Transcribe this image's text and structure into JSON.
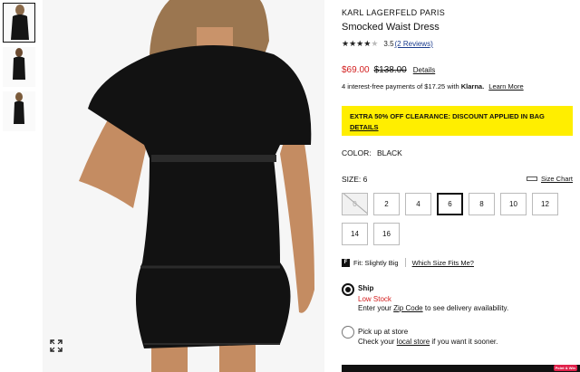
{
  "thumbnails": [
    {
      "name": "thumb-front",
      "active": true
    },
    {
      "name": "thumb-back",
      "active": false
    },
    {
      "name": "thumb-side",
      "active": false
    }
  ],
  "product": {
    "brand": "KARL LAGERFELD PARIS",
    "title": "Smocked Waist Dress",
    "rating_value": 3.5,
    "rating_text": "3.5",
    "reviews_text": "(2 Reviews)",
    "sale_price": "$69.00",
    "original_price": "$138.00",
    "details_label": "Details",
    "klarna_prefix": "4 interest-free payments of $17.25 with",
    "klarna_brand": "Klarna.",
    "klarna_learn_more": "Learn More"
  },
  "promo": {
    "headline": "EXTRA 50% OFF CLEARANCE: DISCOUNT APPLIED IN BAG",
    "link": "DETAILS",
    "background": "#ffee00"
  },
  "color": {
    "label": "COLOR:",
    "value": "BLACK"
  },
  "size": {
    "label": "SIZE:",
    "selected": "6",
    "size_chart_label": "Size Chart",
    "options": [
      {
        "label": "0",
        "state": "unavailable"
      },
      {
        "label": "2",
        "state": "available"
      },
      {
        "label": "4",
        "state": "available"
      },
      {
        "label": "6",
        "state": "selected"
      },
      {
        "label": "8",
        "state": "available"
      },
      {
        "label": "10",
        "state": "available"
      },
      {
        "label": "12",
        "state": "available"
      },
      {
        "label": "14",
        "state": "available"
      },
      {
        "label": "16",
        "state": "available"
      }
    ]
  },
  "fit": {
    "icon_text": "F",
    "label": "Fit: Slightly Big",
    "which_size": "Which Size Fits Me?"
  },
  "fulfillment": {
    "ship": {
      "title": "Ship",
      "stock": "Low Stock",
      "line_prefix": "Enter your",
      "line_link": "Zip Code",
      "line_suffix": "to see delivery availability.",
      "checked": true
    },
    "pickup": {
      "title": "Pick up at store",
      "line_prefix": "Check your",
      "line_link": "local store",
      "line_suffix": "if you want it sooner.",
      "checked": false
    }
  },
  "badge_text": "Point & Win",
  "colors": {
    "sale_red": "#d32020",
    "promo_yellow": "#ffee00",
    "text": "#111111"
  }
}
